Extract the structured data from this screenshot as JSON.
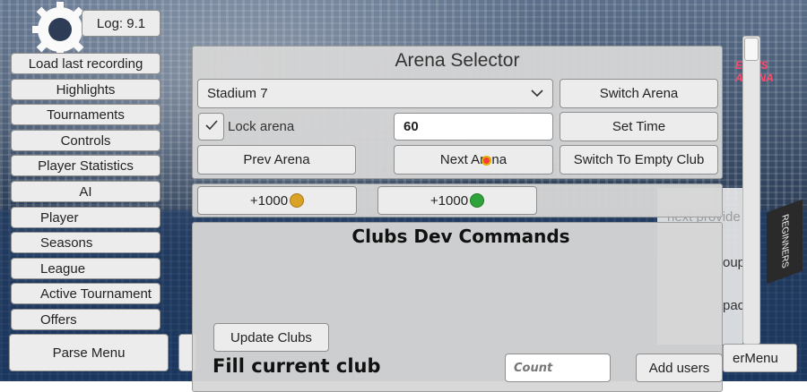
{
  "log": {
    "label": "Log: 9.1"
  },
  "menu": {
    "items": [
      {
        "label": "Load last recording"
      },
      {
        "label": "Highlights"
      },
      {
        "label": "Tournaments"
      },
      {
        "label": "Controls"
      },
      {
        "label": "Player Statistics"
      },
      {
        "label": "AI"
      },
      {
        "label": "Player"
      },
      {
        "label": "Seasons"
      },
      {
        "label": "League"
      },
      {
        "label": "Active Tournament"
      },
      {
        "label": "Offers"
      }
    ],
    "parse_label": "Parse Menu"
  },
  "arena": {
    "title": "Arena Selector",
    "selected_stadium": "Stadium 7",
    "switch_label": "Switch Arena",
    "lock_label": "Lock arena",
    "lock_checked": true,
    "time_value": "60",
    "set_time_label": "Set Time",
    "prev_label": "Prev Arena",
    "next_label": "Next Arena",
    "empty_club_label": "Switch To Empty Club"
  },
  "currency": {
    "gold_label": "+1000",
    "gem_label": "+1000",
    "gold_color": "#d9a227",
    "gem_color": "#2fa33a"
  },
  "clubs": {
    "title": "Clubs Dev Commands",
    "update_label": "Update Clubs",
    "fill_label": "Fill current club",
    "count_placeholder": "Count",
    "add_users_label": "Add users"
  },
  "background_ui": {
    "next_provider": "next provide",
    "group": "oup",
    "space": "pace",
    "menu_fragment": "erMenu",
    "banner": "ENNIS ARENA",
    "sign": "REGINNERS"
  }
}
